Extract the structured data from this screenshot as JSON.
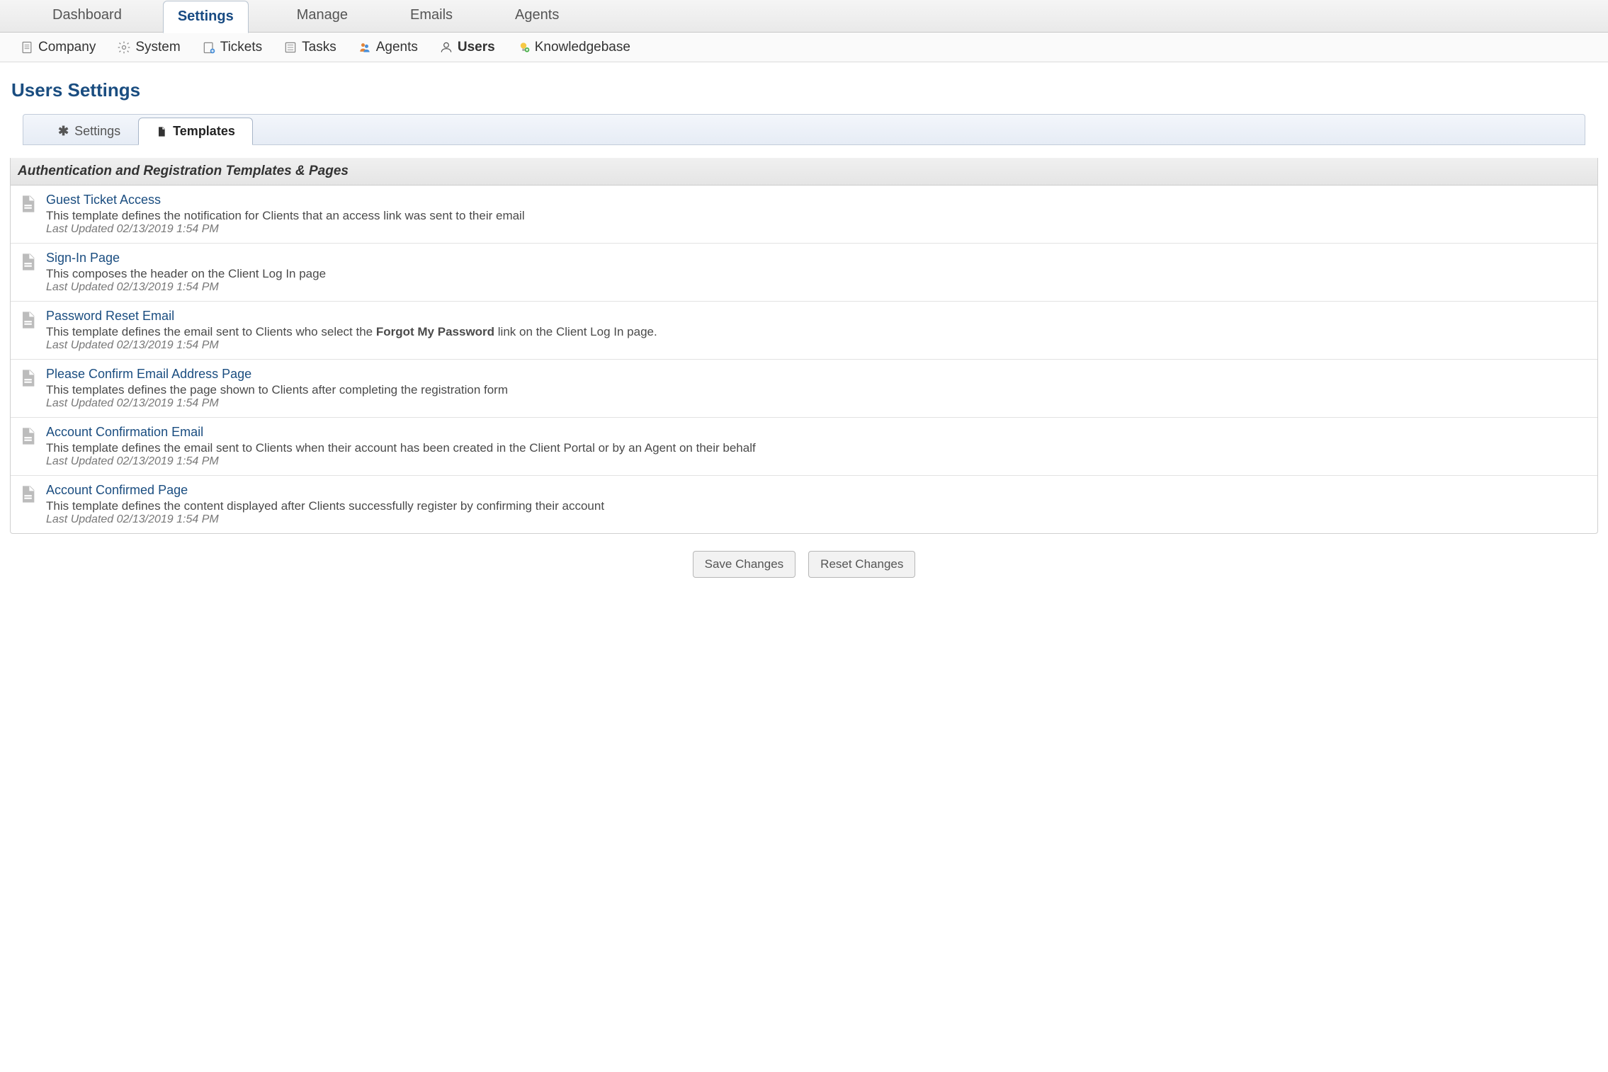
{
  "topTabs": {
    "dashboard": "Dashboard",
    "settings": "Settings",
    "manage": "Manage",
    "emails": "Emails",
    "agents": "Agents"
  },
  "subnav": {
    "company": "Company",
    "system": "System",
    "tickets": "Tickets",
    "tasks": "Tasks",
    "agents": "Agents",
    "users": "Users",
    "kb": "Knowledgebase"
  },
  "pageTitle": "Users Settings",
  "subtabs": {
    "settings": "Settings",
    "templates": "Templates"
  },
  "sectionHeader": "Authentication and Registration Templates & Pages",
  "updatedPrefix": "Last Updated ",
  "templates": [
    {
      "title": "Guest Ticket Access",
      "desc": "This template defines the notification for Clients that an access link was sent to their email",
      "updated": "02/13/2019 1:54 PM"
    },
    {
      "title": "Sign-In Page",
      "desc": "This composes the header on the Client Log In page",
      "updated": "02/13/2019 1:54 PM"
    },
    {
      "title": "Password Reset Email",
      "descPre": "This template defines the email sent to Clients who select the ",
      "descBold": "Forgot My Password",
      "descPost": " link on the Client Log In page.",
      "updated": "02/13/2019 1:54 PM"
    },
    {
      "title": "Please Confirm Email Address Page",
      "desc": "This templates defines the page shown to Clients after completing the registration form",
      "updated": "02/13/2019 1:54 PM"
    },
    {
      "title": "Account Confirmation Email",
      "desc": "This template defines the email sent to Clients when their account has been created in the Client Portal or by an Agent on their behalf",
      "updated": "02/13/2019 1:54 PM"
    },
    {
      "title": "Account Confirmed Page",
      "desc": "This template defines the content displayed after Clients successfully register by confirming their account",
      "updated": "02/13/2019 1:54 PM"
    }
  ],
  "buttons": {
    "save": "Save Changes",
    "reset": "Reset Changes"
  }
}
